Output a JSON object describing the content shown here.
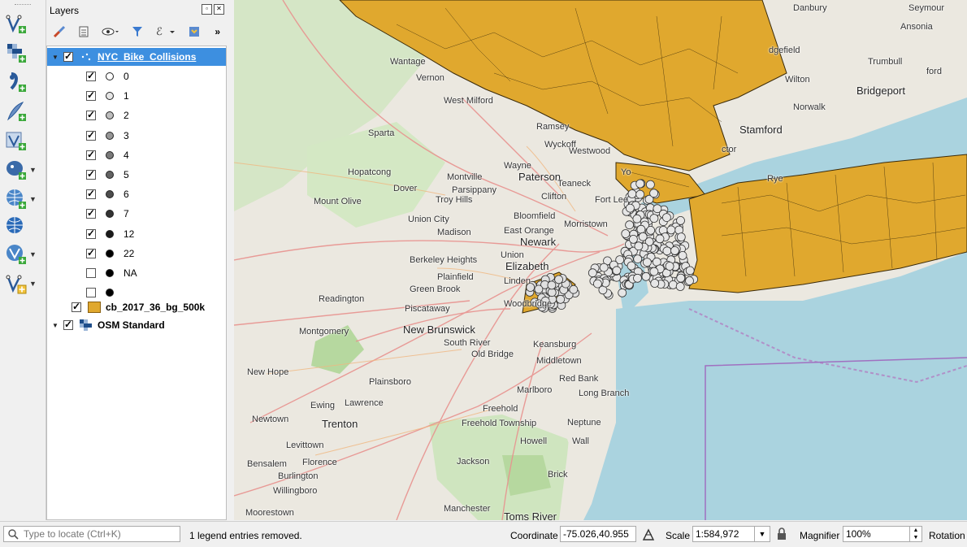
{
  "toolbar": {
    "tools": [
      {
        "name": "digitize-vector-icon",
        "has_menu": false
      },
      {
        "name": "add-raster-icon",
        "has_menu": false
      },
      {
        "name": "add-delimited-text-icon",
        "has_menu": false
      },
      {
        "name": "add-spatialite-icon",
        "has_menu": false
      },
      {
        "name": "add-virtual-layer-icon",
        "has_menu": false
      },
      {
        "name": "add-postgis-icon",
        "has_menu": true
      },
      {
        "name": "add-wms-icon",
        "has_menu": true
      },
      {
        "name": "add-wfs-icon",
        "has_menu": false
      },
      {
        "name": "new-shapefile-icon",
        "has_menu": true
      },
      {
        "name": "new-scratch-layer-icon",
        "has_menu": true
      }
    ]
  },
  "layers_panel": {
    "title": "Layers",
    "more": "»",
    "layers": [
      {
        "name": "NYC_Bike_Collisions",
        "checked": true,
        "selected": true,
        "expanded": true,
        "classes": [
          {
            "label": "0",
            "checked": true,
            "fill": "#ffffff"
          },
          {
            "label": "1",
            "checked": true,
            "fill": "#e6e6e6"
          },
          {
            "label": "2",
            "checked": true,
            "fill": "#bdbdbd"
          },
          {
            "label": "3",
            "checked": true,
            "fill": "#969696"
          },
          {
            "label": "4",
            "checked": true,
            "fill": "#7a7a7a"
          },
          {
            "label": "5",
            "checked": true,
            "fill": "#636363"
          },
          {
            "label": "6",
            "checked": true,
            "fill": "#4d4d4d"
          },
          {
            "label": "7",
            "checked": true,
            "fill": "#333333"
          },
          {
            "label": "12",
            "checked": true,
            "fill": "#1a1a1a"
          },
          {
            "label": "22",
            "checked": true,
            "fill": "#000000"
          },
          {
            "label": "NA",
            "checked": false,
            "fill": "#000000"
          },
          {
            "label": "",
            "checked": false,
            "fill": "#000000"
          }
        ]
      },
      {
        "name": "cb_2017_36_bg_500k",
        "checked": true,
        "selected": false,
        "fill": "#e0a82e"
      },
      {
        "name": "OSM Standard",
        "checked": true,
        "selected": false,
        "expanded": true
      }
    ]
  },
  "map": {
    "places": [
      {
        "text": "Danbury",
        "big": false
      },
      {
        "text": "Seymour",
        "big": false
      },
      {
        "text": "Ansonia",
        "big": false
      },
      {
        "text": "Wantage",
        "big": false
      },
      {
        "text": "Vernon",
        "big": false
      },
      {
        "text": "Trumbull",
        "big": false
      },
      {
        "text": "Wilton",
        "big": false
      },
      {
        "text": "Bridgeport",
        "big": true
      },
      {
        "text": "West Milford",
        "big": false
      },
      {
        "text": "Norwalk",
        "big": false
      },
      {
        "text": "Stamford",
        "big": true
      },
      {
        "text": "Ramsey",
        "big": false
      },
      {
        "text": "Sparta",
        "big": false
      },
      {
        "text": "Wyckoff",
        "big": false
      },
      {
        "text": "Westwood",
        "big": false
      },
      {
        "text": "Wayne",
        "big": false
      },
      {
        "text": "Hopatcong",
        "big": false
      },
      {
        "text": "Montville",
        "big": false
      },
      {
        "text": "Paterson",
        "big": true
      },
      {
        "text": "Teaneck",
        "big": false
      },
      {
        "text": "Dover",
        "big": false
      },
      {
        "text": "Parsippany",
        "big": false
      },
      {
        "text": "Troy Hills",
        "big": false
      },
      {
        "text": "Clifton",
        "big": false
      },
      {
        "text": "Fort Lee",
        "big": false
      },
      {
        "text": "Mount Olive",
        "big": false
      },
      {
        "text": "Bloomfield",
        "big": false
      },
      {
        "text": "Morristown",
        "big": false
      },
      {
        "text": "Union City",
        "big": false
      },
      {
        "text": "Madison",
        "big": false
      },
      {
        "text": "East Orange",
        "big": false
      },
      {
        "text": "Newark",
        "big": true
      },
      {
        "text": "Berkeley Heights",
        "big": false
      },
      {
        "text": "Union",
        "big": false
      },
      {
        "text": "Elizabeth",
        "big": true
      },
      {
        "text": "Plainfield",
        "big": false
      },
      {
        "text": "Linden",
        "big": false
      },
      {
        "text": "Green Brook",
        "big": false
      },
      {
        "text": "Readington",
        "big": false
      },
      {
        "text": "Piscataway",
        "big": false
      },
      {
        "text": "Woodbridge",
        "big": false
      },
      {
        "text": "Montgomery",
        "big": false
      },
      {
        "text": "New Brunswick",
        "big": true
      },
      {
        "text": "South River",
        "big": false
      },
      {
        "text": "Keansburg",
        "big": false
      },
      {
        "text": "Old Bridge",
        "big": false
      },
      {
        "text": "Middletown",
        "big": false
      },
      {
        "text": "New Hope",
        "big": false
      },
      {
        "text": "Red Bank",
        "big": false
      },
      {
        "text": "Plainsboro",
        "big": false
      },
      {
        "text": "Long Branch",
        "big": false
      },
      {
        "text": "Marlboro",
        "big": false
      },
      {
        "text": "Ewing",
        "big": false
      },
      {
        "text": "Lawrence",
        "big": false
      },
      {
        "text": "Freehold",
        "big": false
      },
      {
        "text": "Newtown",
        "big": false
      },
      {
        "text": "Trenton",
        "big": true
      },
      {
        "text": "Freehold Township",
        "big": false
      },
      {
        "text": "Neptune",
        "big": false
      },
      {
        "text": "Levittown",
        "big": false
      },
      {
        "text": "Howell",
        "big": false
      },
      {
        "text": "Wall",
        "big": false
      },
      {
        "text": "Bensalem",
        "big": false
      },
      {
        "text": "Florence",
        "big": false
      },
      {
        "text": "Jackson",
        "big": false
      },
      {
        "text": "Burlington",
        "big": false
      },
      {
        "text": "Brick",
        "big": false
      },
      {
        "text": "Willingboro",
        "big": false
      },
      {
        "text": "Manchester",
        "big": false
      },
      {
        "text": "Moorestown",
        "big": false
      },
      {
        "text": "Toms River",
        "big": true
      },
      {
        "text": "Yo",
        "big": false
      },
      {
        "text": "ctor",
        "big": false
      },
      {
        "text": "Rye",
        "big": false
      },
      {
        "text": "dgefield",
        "big": false
      },
      {
        "text": "ford",
        "big": false
      }
    ]
  },
  "status": {
    "locate_placeholder": "Type to locate (Ctrl+K)",
    "message": "1 legend entries removed.",
    "coordinate_label": "Coordinate",
    "coordinate_value": "-75.026,40.955",
    "scale_label": "Scale",
    "scale_value": "1:584,972",
    "magnifier_label": "Magnifier",
    "magnifier_value": "100%",
    "rotation_label": "Rotation"
  }
}
